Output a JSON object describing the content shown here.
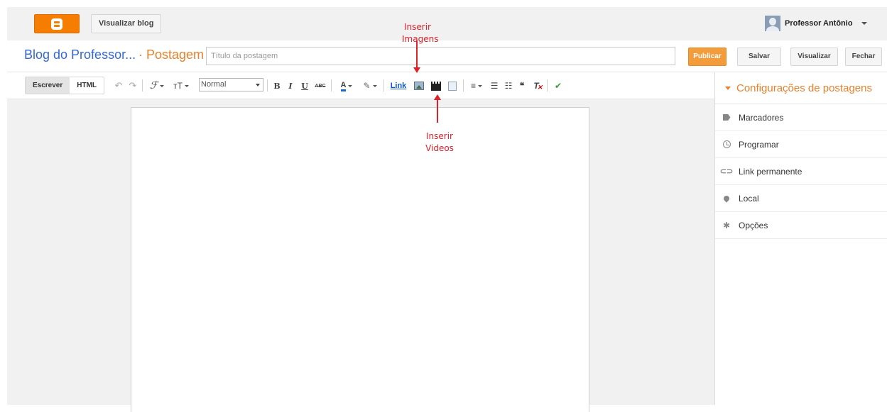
{
  "header": {
    "view_blog_label": "Visualizar blog",
    "user_name": "Professor Antônio"
  },
  "title_row": {
    "blog_name": "Blog do Professor...",
    "separator_label": "· Postagem",
    "title_placeholder": "Título da postagem",
    "publish_label": "Publicar",
    "save_label": "Salvar",
    "preview_label": "Visualizar",
    "close_label": "Fechar"
  },
  "toolbar": {
    "mode_write": "Escrever",
    "mode_html": "HTML",
    "font_size_select": "Normal",
    "bold": "B",
    "italic": "I",
    "underline": "U",
    "strike": "ABC",
    "font_family_glyph": "ℱ",
    "font_size_glyph": "тT",
    "link_label": "Link",
    "icons": [
      "undo-icon",
      "redo-icon",
      "font-family-icon",
      "font-size-icon",
      "bold-icon",
      "italic-icon",
      "underline-icon",
      "strikethrough-icon",
      "text-color-icon",
      "highlight-icon",
      "link",
      "insert-image-icon",
      "insert-video-icon",
      "insert-jump-break-icon",
      "align-icon",
      "numbered-list-icon",
      "bullet-list-icon",
      "quote-icon",
      "clear-format-icon",
      "spell-check-icon"
    ]
  },
  "sidebar": {
    "heading": "Configurações de postagens",
    "items": [
      {
        "label": "Marcadores",
        "icon": "tag-icon"
      },
      {
        "label": "Programar",
        "icon": "clock-icon"
      },
      {
        "label": "Link permanente",
        "icon": "link-icon"
      },
      {
        "label": "Local",
        "icon": "location-pin-icon"
      },
      {
        "label": "Opções",
        "icon": "gear-icon"
      }
    ]
  },
  "annotations": {
    "insert_images_line1": "Inserir",
    "insert_images_line2": "Imagens",
    "insert_videos_line1": "Inserir",
    "insert_videos_line2": "Videos"
  },
  "colors": {
    "accent_orange": "#f57d00",
    "blog_name_blue": "#3367d6",
    "annotation_red": "#e0202a"
  }
}
